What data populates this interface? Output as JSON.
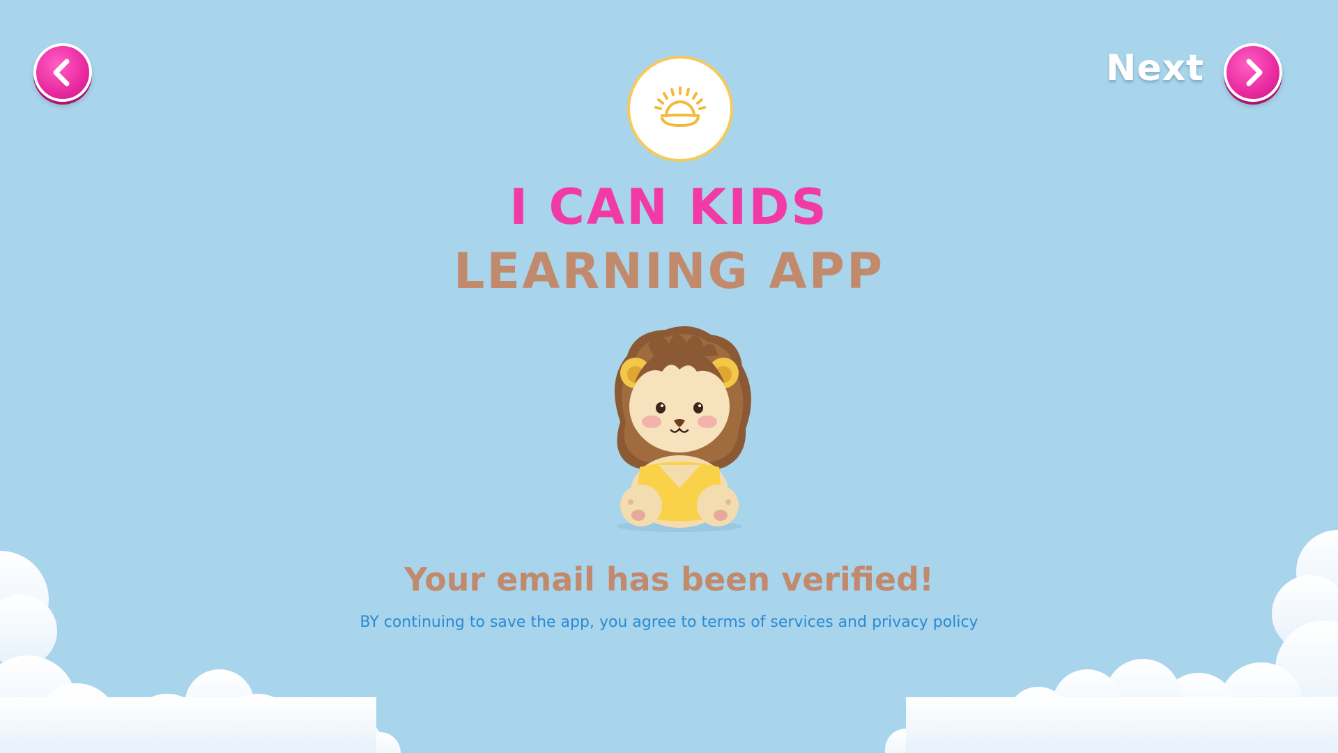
{
  "nav": {
    "back_icon": "chevron-left-icon",
    "next_label": "Next",
    "next_icon": "chevron-right-icon"
  },
  "logo": {
    "icon": "sunrise-icon"
  },
  "title": {
    "line1": "I CAN KIDS",
    "line2": "LEARNING APP"
  },
  "mascot": {
    "icon": "lion-mascot"
  },
  "message": {
    "heading": "Your email has been verified!",
    "terms_prefix": "BY continuing to save the app, you agree to ",
    "terms_link": "terms of services",
    "terms_middle": " and ",
    "privacy_link": "privacy policy"
  },
  "colors": {
    "background": "#a8d4ec",
    "accent_pink": "#f23aa6",
    "brown": "#c28a6c",
    "link_blue": "#2a8ad4",
    "logo_yellow": "#f7c95a"
  }
}
